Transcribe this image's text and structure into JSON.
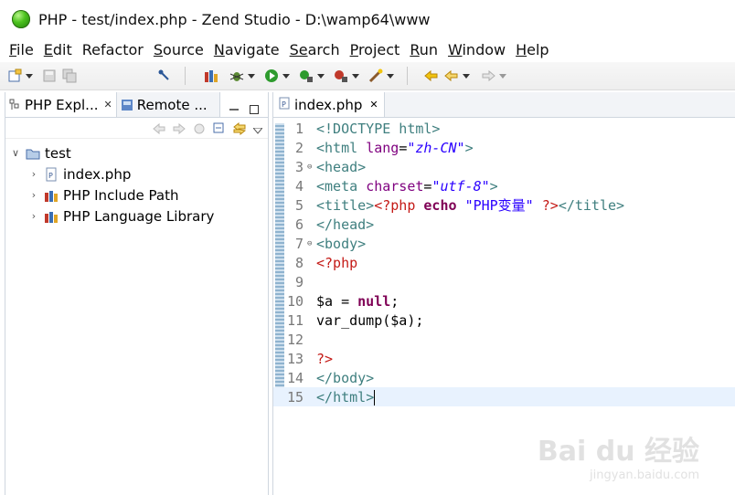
{
  "window": {
    "title": "PHP - test/index.php - Zend Studio - D:\\wamp64\\www"
  },
  "menu": [
    {
      "label_first": "F",
      "label_rest": "ile"
    },
    {
      "label_first": "E",
      "label_rest": "dit"
    },
    {
      "label_first": "",
      "label_rest": "Refactor"
    },
    {
      "label_first": "S",
      "label_rest": "ource"
    },
    {
      "label_first": "N",
      "label_rest": "avigate"
    },
    {
      "label_first": "Se",
      "label_rest": "arch"
    },
    {
      "label_first": "P",
      "label_rest": "roject"
    },
    {
      "label_first": "R",
      "label_rest": "un"
    },
    {
      "label_first": "W",
      "label_rest": "indow"
    },
    {
      "label_first": "H",
      "label_rest": "elp"
    }
  ],
  "left_panel": {
    "tabs": [
      {
        "label": "PHP Expl..."
      },
      {
        "label": "Remote ..."
      }
    ],
    "tree": [
      {
        "label": "test",
        "level": 0,
        "expanded": true
      },
      {
        "label": "index.php",
        "level": 1
      },
      {
        "label": "PHP Include Path",
        "level": 1
      },
      {
        "label": "PHP Language Library",
        "level": 1
      }
    ]
  },
  "editor": {
    "tab_label": "index.php",
    "current_line": 15,
    "lines": [
      {
        "n": "1",
        "fold": ""
      },
      {
        "n": "2",
        "fold": ""
      },
      {
        "n": "3",
        "fold": "⊖"
      },
      {
        "n": "4",
        "fold": ""
      },
      {
        "n": "5",
        "fold": ""
      },
      {
        "n": "6",
        "fold": ""
      },
      {
        "n": "7",
        "fold": "⊖"
      },
      {
        "n": "8",
        "fold": ""
      },
      {
        "n": "9",
        "fold": ""
      },
      {
        "n": "10",
        "fold": ""
      },
      {
        "n": "11",
        "fold": ""
      },
      {
        "n": "12",
        "fold": ""
      },
      {
        "n": "13",
        "fold": ""
      },
      {
        "n": "14",
        "fold": ""
      },
      {
        "n": "15",
        "fold": ""
      }
    ],
    "code": {
      "l1_tag": "<!DOCTYPE html>",
      "l2_open": "<html ",
      "l2_attr": "lang",
      "l2_eq": "=",
      "l2_val": "\"zh-CN\"",
      "l2_close": ">",
      "l3": "<head>",
      "l4_open": "<meta ",
      "l4_attr": "charset",
      "l4_eq": "=",
      "l4_val": "\"utf-8\"",
      "l4_close": ">",
      "l5_open": "<title>",
      "l5_php": "<?php",
      "l5_kw": " echo ",
      "l5_str": "\"PHP变量\"",
      "l5_end": " ?>",
      "l5_close": "</title>",
      "l6": "</head>",
      "l7": "<body>",
      "l8": "<?php",
      "l10_var": "$a = ",
      "l10_kw": "null",
      "l10_end": ";",
      "l11": "var_dump($a);",
      "l13": "?>",
      "l14": "</body>",
      "l15_lt": "</",
      "l15_tag": "html",
      "l15_gt": ">"
    }
  },
  "watermark": {
    "main": "Bai du 经验",
    "sub": "jingyan.baidu.com"
  }
}
